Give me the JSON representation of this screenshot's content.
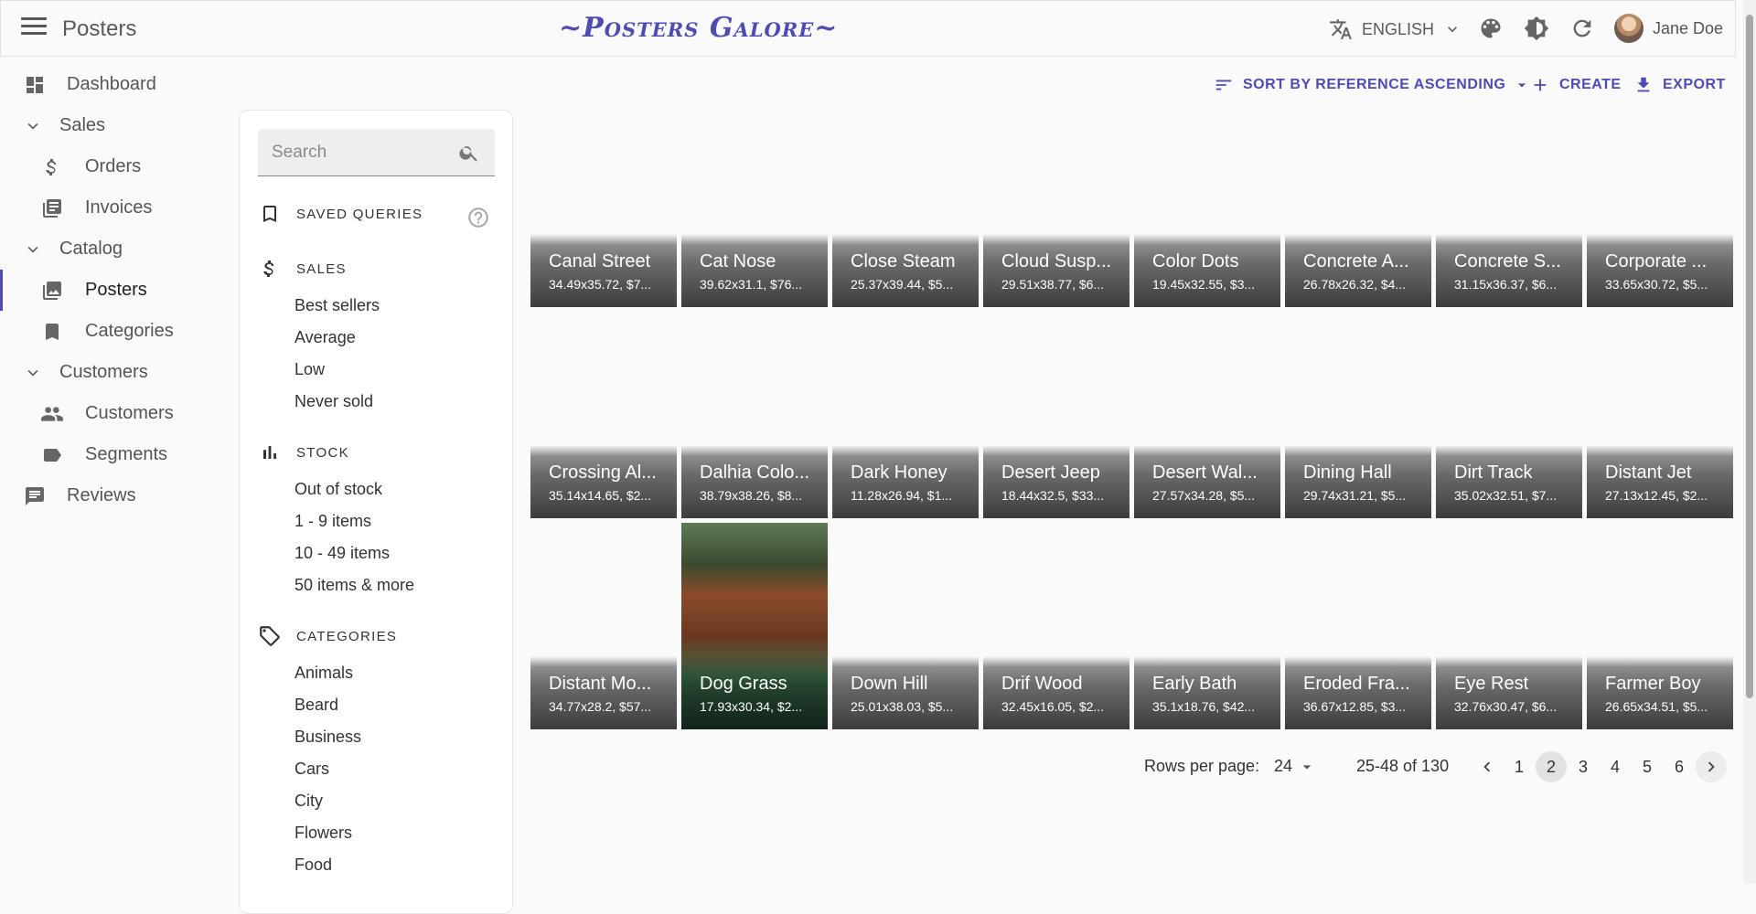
{
  "header": {
    "title": "Posters",
    "brand": "~Posters Galore~",
    "language": "ENGLISH",
    "user_name": "Jane Doe"
  },
  "sidebar": {
    "items": [
      {
        "label": "Dashboard",
        "icon": "dashboard-icon"
      },
      {
        "label": "Sales",
        "icon": "chevron-down-icon"
      },
      {
        "label": "Orders",
        "icon": "dollar-icon"
      },
      {
        "label": "Invoices",
        "icon": "invoices-icon"
      },
      {
        "label": "Catalog",
        "icon": "chevron-down-icon"
      },
      {
        "label": "Posters",
        "icon": "image-icon"
      },
      {
        "label": "Categories",
        "icon": "bookmark-icon"
      },
      {
        "label": "Customers",
        "icon": "chevron-down-icon"
      },
      {
        "label": "Customers",
        "icon": "people-icon"
      },
      {
        "label": "Segments",
        "icon": "label-icon"
      },
      {
        "label": "Reviews",
        "icon": "comment-icon"
      }
    ]
  },
  "filters": {
    "search_placeholder": "Search",
    "saved_queries": "SAVED QUERIES",
    "sales": {
      "title": "SALES",
      "items": [
        "Best sellers",
        "Average",
        "Low",
        "Never sold"
      ]
    },
    "stock": {
      "title": "STOCK",
      "items": [
        "Out of stock",
        "1 - 9 items",
        "10 - 49 items",
        "50 items & more"
      ]
    },
    "categories": {
      "title": "CATEGORIES",
      "items": [
        "Animals",
        "Beard",
        "Business",
        "Cars",
        "City",
        "Flowers",
        "Food"
      ]
    }
  },
  "toolbar": {
    "sort": "SORT BY REFERENCE ASCENDING",
    "create": "CREATE",
    "export": "EXPORT"
  },
  "posters": [
    {
      "title": "Canal Street",
      "sub": "34.49x35.72, $7..."
    },
    {
      "title": "Cat Nose",
      "sub": "39.62x31.1, $76..."
    },
    {
      "title": "Close Steam",
      "sub": "25.37x39.44, $5..."
    },
    {
      "title": "Cloud Susp...",
      "sub": "29.51x38.77, $6..."
    },
    {
      "title": "Color Dots",
      "sub": "19.45x32.55, $3..."
    },
    {
      "title": "Concrete A...",
      "sub": "26.78x26.32, $4..."
    },
    {
      "title": "Concrete S...",
      "sub": "31.15x36.37, $6..."
    },
    {
      "title": "Corporate ...",
      "sub": "33.65x30.72, $5..."
    },
    {
      "title": "Crossing Al...",
      "sub": "35.14x14.65, $2..."
    },
    {
      "title": "Dalhia Colo...",
      "sub": "38.79x38.26, $8..."
    },
    {
      "title": "Dark Honey",
      "sub": "11.28x26.94, $1..."
    },
    {
      "title": "Desert Jeep",
      "sub": "18.44x32.5, $33..."
    },
    {
      "title": "Desert Wal...",
      "sub": "27.57x34.28, $5..."
    },
    {
      "title": "Dining Hall",
      "sub": "29.74x31.21, $5..."
    },
    {
      "title": "Dirt Track",
      "sub": "35.02x32.51, $7..."
    },
    {
      "title": "Distant Jet",
      "sub": "27.13x12.45, $2..."
    },
    {
      "title": "Distant Mo...",
      "sub": "34.77x28.2, $57..."
    },
    {
      "title": "Dog Grass",
      "sub": "17.93x30.34, $2..."
    },
    {
      "title": "Down Hill",
      "sub": "25.01x38.03, $5..."
    },
    {
      "title": "Drif Wood",
      "sub": "32.45x16.05, $2..."
    },
    {
      "title": "Early Bath",
      "sub": "35.1x18.76, $42..."
    },
    {
      "title": "Eroded Fra...",
      "sub": "36.67x12.85, $3..."
    },
    {
      "title": "Eye Rest",
      "sub": "32.76x30.47, $6..."
    },
    {
      "title": "Farmer Boy",
      "sub": "26.65x34.51, $5..."
    }
  ],
  "pagination": {
    "rows_label": "Rows per page:",
    "rows_value": "24",
    "range": "25-48 of 130",
    "pages": [
      "1",
      "2",
      "3",
      "4",
      "5",
      "6"
    ],
    "current": "2"
  },
  "colors": {
    "accent": "#4f4bb3"
  }
}
